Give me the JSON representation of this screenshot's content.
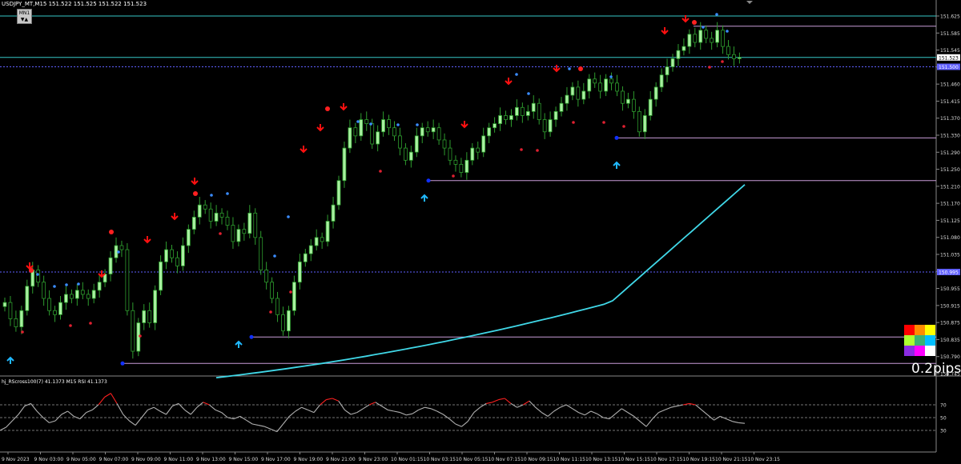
{
  "header": {
    "title": "USDJPY_MT,M15  151.522 151.525 151.522 151.523",
    "timeframe_button": "MN1",
    "tf_arrows": "▼▲"
  },
  "price_axis": {
    "labels": [
      "151.625",
      "151.585",
      "151.545",
      "151.505",
      "151.460",
      "151.415",
      "151.370",
      "151.330",
      "151.290",
      "151.250",
      "151.210",
      "151.170",
      "151.125",
      "151.080",
      "151.035",
      "150.995",
      "150.955",
      "150.915",
      "150.875",
      "150.835",
      "150.790",
      "150.745"
    ],
    "current_tag": "151.523",
    "ask_tag": "151.500",
    "dotted_tag": "150.995"
  },
  "time_axis": {
    "labels": [
      "9 Nov 2023",
      "9 Nov 03:00",
      "9 Nov 05:00",
      "9 Nov 07:00",
      "9 Nov 09:00",
      "9 Nov 11:00",
      "9 Nov 13:00",
      "9 Nov 15:00",
      "9 Nov 17:00",
      "9 Nov 19:00",
      "9 Nov 21:00",
      "9 Nov 23:00",
      "10 Nov 01:15",
      "10 Nov 03:15",
      "10 Nov 05:15",
      "10 Nov 07:15",
      "10 Nov 09:15",
      "10 Nov 11:15",
      "10 Nov 13:15",
      "10 Nov 15:15",
      "10 Nov 17:15",
      "10 Nov 19:15",
      "10 Nov 21:15",
      "10 Nov 23:15"
    ]
  },
  "rsi_panel": {
    "header": "hj_RScross100(7) 41.1373  M15 RSI  41.1373",
    "levels": [
      "70",
      "50",
      "30"
    ]
  },
  "overlay": {
    "pips_label": "0.2pips",
    "palette": [
      "#ff0000",
      "#ff8c00",
      "#ffff00",
      "#adff2f",
      "#3cb371",
      "#00bfff",
      "#8a2be2",
      "#ff00ff",
      "#ffffff"
    ]
  },
  "colors": {
    "bull": "#a8f0a0",
    "wick": "#2e9c2e",
    "sma": "#40d8e8",
    "sell_arrow": "#ff1010",
    "buy_arrow": "#20b8ff",
    "level_line": "#c89cd8",
    "current_line": "#36c8c8",
    "rsi": "#b0b0b0"
  },
  "chart_data": {
    "type": "candlestick",
    "symbol": "USDJPY_MT",
    "timeframe": "M15",
    "ylim": [
      150.745,
      151.625
    ],
    "current_price": 151.523,
    "close": [
      150.92,
      150.88,
      150.86,
      150.9,
      150.96,
      151.0,
      150.97,
      150.93,
      150.9,
      150.89,
      150.92,
      150.94,
      150.93,
      150.95,
      150.94,
      150.93,
      150.95,
      150.97,
      150.99,
      151.03,
      151.06,
      151.05,
      150.9,
      150.8,
      150.87,
      150.9,
      150.87,
      150.95,
      151.02,
      151.05,
      151.03,
      151.01,
      151.06,
      151.1,
      151.13,
      151.16,
      151.15,
      151.12,
      151.14,
      151.13,
      151.11,
      151.07,
      151.1,
      151.09,
      151.14,
      151.08,
      151.0,
      150.97,
      150.93,
      150.89,
      150.85,
      150.9,
      150.97,
      151.02,
      151.04,
      151.06,
      151.08,
      151.07,
      151.12,
      151.16,
      151.22,
      151.3,
      151.35,
      151.33,
      151.37,
      151.36,
      151.31,
      151.34,
      151.37,
      151.35,
      151.33,
      151.3,
      151.27,
      151.29,
      151.33,
      151.35,
      151.34,
      151.35,
      151.32,
      151.3,
      151.27,
      151.26,
      151.24,
      151.27,
      151.3,
      151.29,
      151.33,
      151.35,
      151.36,
      151.38,
      151.37,
      151.38,
      151.4,
      151.38,
      151.39,
      151.41,
      151.37,
      151.34,
      151.37,
      151.39,
      151.41,
      151.43,
      151.45,
      151.42,
      151.44,
      151.47,
      151.46,
      151.44,
      151.47,
      151.46,
      151.44,
      151.41,
      151.42,
      151.39,
      151.34,
      151.38,
      151.42,
      151.45,
      151.48,
      151.5,
      151.52,
      151.54,
      151.55,
      151.58,
      151.56,
      151.59,
      151.57,
      151.56,
      151.59,
      151.55,
      151.53,
      151.52,
      151.523
    ],
    "sma": [
      [
        0,
        150.735
      ],
      [
        100,
        150.92
      ],
      [
        134,
        151.21
      ]
    ],
    "support_levels": [
      150.77,
      150.835,
      151.22,
      151.325
    ],
    "resistance_levels": [
      151.6
    ],
    "dotted_level": 150.995,
    "rsi_values": [
      30,
      35,
      45,
      55,
      68,
      72,
      60,
      50,
      42,
      45,
      55,
      60,
      52,
      48,
      58,
      62,
      70,
      82,
      88,
      72,
      55,
      45,
      38,
      50,
      62,
      66,
      60,
      55,
      68,
      72,
      62,
      55,
      66,
      74,
      70,
      62,
      58,
      50,
      48,
      52,
      46,
      40,
      38,
      36,
      32,
      28,
      40,
      52,
      60,
      66,
      62,
      58,
      70,
      78,
      80,
      76,
      62,
      55,
      58,
      64,
      70,
      74,
      68,
      62,
      60,
      58,
      54,
      56,
      62,
      66,
      64,
      60,
      55,
      48,
      40,
      36,
      44,
      58,
      66,
      72,
      74,
      78,
      80,
      72,
      66,
      70,
      76,
      66,
      58,
      52,
      60,
      66,
      70,
      64,
      58,
      54,
      60,
      56,
      50,
      48,
      56,
      64,
      58,
      52,
      44,
      36,
      48,
      58,
      62,
      66,
      68,
      70,
      72,
      70,
      62,
      54,
      46,
      52,
      48,
      44,
      42,
      41
    ]
  }
}
